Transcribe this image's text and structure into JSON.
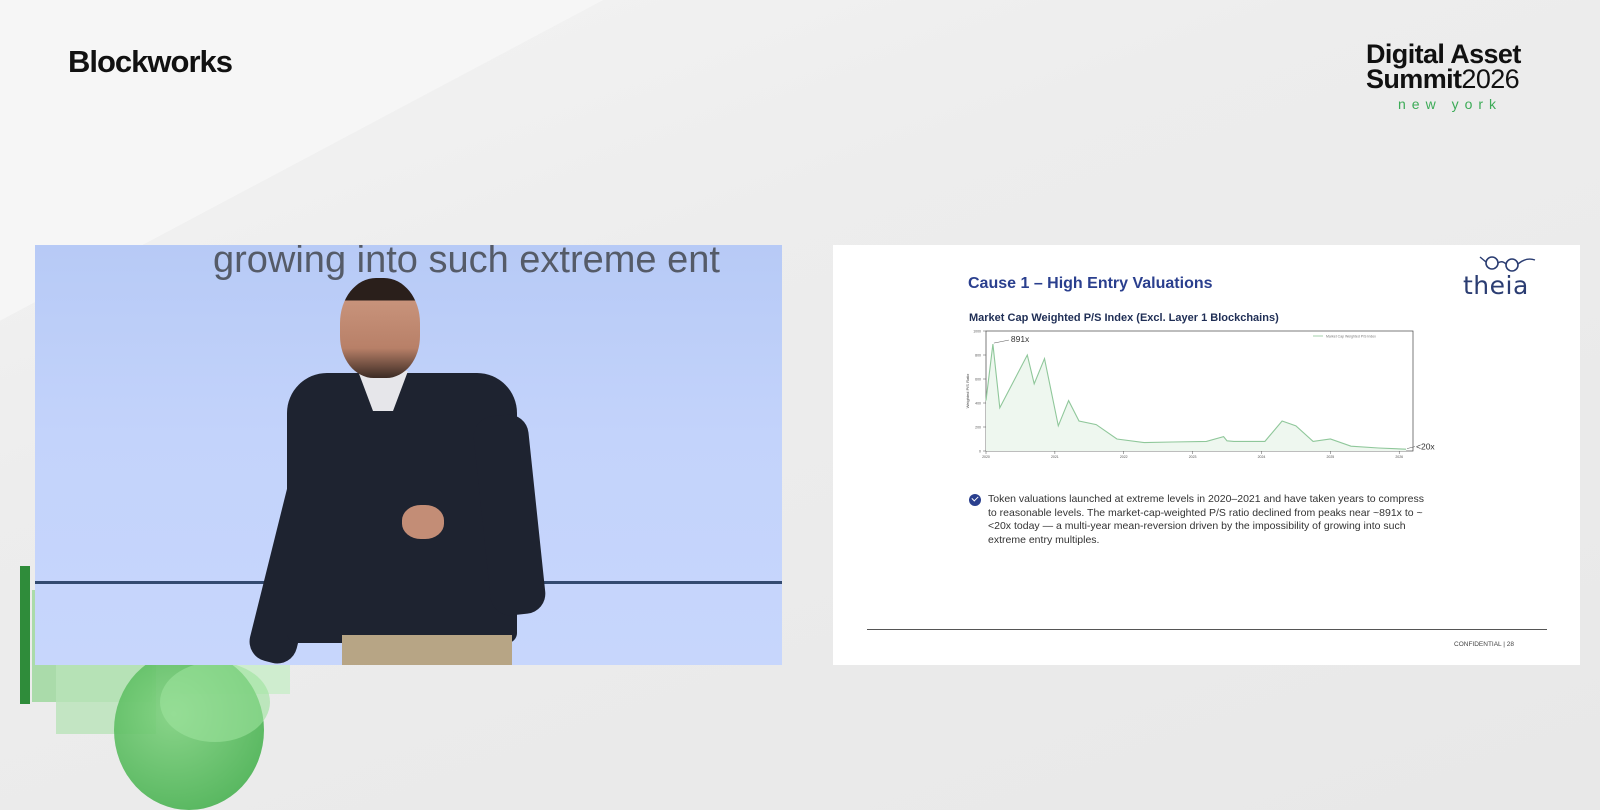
{
  "branding": {
    "left_logo": "Blockworks",
    "right_logo_line1": "Digital Asset",
    "right_logo_line2_word": "Summit",
    "right_logo_year": "2026",
    "right_logo_city": "new york",
    "accent_green": "#3cab57"
  },
  "video": {
    "background_text": "growing into such extreme ent"
  },
  "slide": {
    "title": "Cause 1 – High Entry Valuations",
    "logo_text": "theia",
    "chart_title": "Market Cap Weighted P/S Index (Excl. Layer 1 Blockchains)",
    "bullet_text": "Token valuations launched at extreme levels in 2020–2021 and have taken years to compress to reasonable levels. The market-cap-weighted P/S ratio declined from peaks near ~891x to ~<20x today — a multi-year mean-reversion driven by the impossibility of growing into such extreme entry multiples.",
    "footer": "CONFIDENTIAL | 28",
    "accent_blue": "#2a3f8e"
  },
  "chart_data": {
    "type": "area",
    "title": "Market Cap Weighted P/S Index (Excl. Layer 1 Blockchains)",
    "ylabel": "Weighted P/S Ratio",
    "xlabel": "",
    "legend": "Market Cap Weighted P/S Index",
    "legend_position": "top-right",
    "xlim": [
      2020,
      2026.2
    ],
    "ylim": [
      0,
      1000
    ],
    "x_ticks": [
      "2020",
      "2021",
      "2022",
      "2023",
      "2024",
      "2025",
      "2026"
    ],
    "y_ticks": [
      "0",
      "200",
      "400",
      "600",
      "800",
      "1000"
    ],
    "annotations": [
      {
        "text": "891x",
        "x": 2020.1,
        "y": 891
      },
      {
        "text": "<20x",
        "x": 2026.2,
        "y": 20
      }
    ],
    "series": [
      {
        "name": "Market Cap Weighted P/S Index",
        "color": "#8fc79a",
        "x": [
          2020.0,
          2020.1,
          2020.2,
          2020.6,
          2020.7,
          2020.85,
          2021.05,
          2021.2,
          2021.35,
          2021.6,
          2021.9,
          2022.3,
          2022.7,
          2023.2,
          2023.45,
          2023.5,
          2023.6,
          2024.05,
          2024.3,
          2024.5,
          2024.75,
          2025.0,
          2025.3,
          2025.7,
          2026.1
        ],
        "values": [
          420,
          891,
          360,
          800,
          560,
          770,
          210,
          420,
          250,
          220,
          100,
          70,
          75,
          80,
          120,
          85,
          80,
          80,
          250,
          210,
          80,
          100,
          40,
          25,
          15
        ]
      }
    ]
  }
}
